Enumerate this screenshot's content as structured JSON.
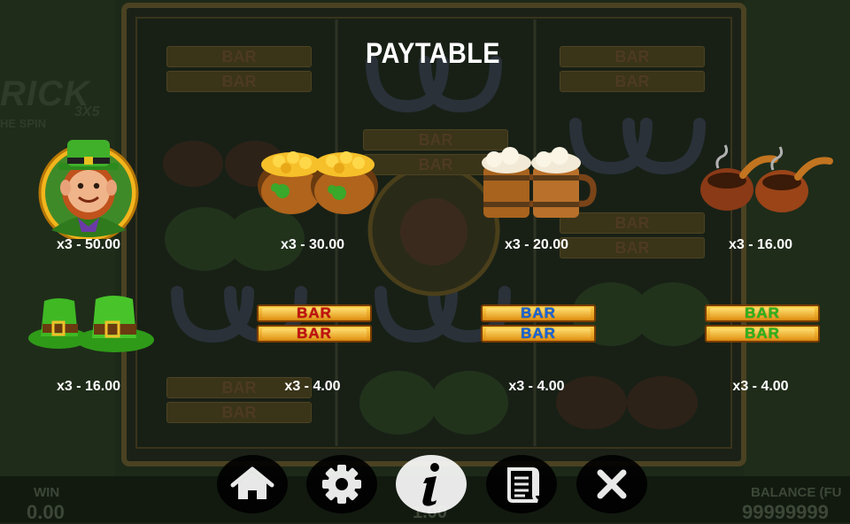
{
  "paytable": {
    "title": "PAYTABLE",
    "entries": [
      {
        "symbol": "leprechaun",
        "payout": "x3 - 50.00"
      },
      {
        "symbol": "pots-of-gold",
        "payout": "x3 - 30.00"
      },
      {
        "symbol": "beer-mugs",
        "payout": "x3 - 20.00"
      },
      {
        "symbol": "smoking-pipes",
        "payout": "x3 - 16.00"
      },
      {
        "symbol": "green-hats",
        "payout": "x3 - 16.00"
      },
      {
        "symbol": "red-bar",
        "payout": "x3 - 4.00",
        "bar_text": "BAR",
        "bar_color": "#c41010"
      },
      {
        "symbol": "blue-bar",
        "payout": "x3 - 4.00",
        "bar_text": "BAR",
        "bar_color": "#1a64d8"
      },
      {
        "symbol": "green-bar",
        "payout": "x3 - 4.00",
        "bar_text": "BAR",
        "bar_color": "#2cb51c"
      }
    ]
  },
  "menu": [
    {
      "name": "home",
      "icon": "home-icon"
    },
    {
      "name": "settings",
      "icon": "gear-icon"
    },
    {
      "name": "info",
      "icon": "info-icon",
      "active": true
    },
    {
      "name": "rules",
      "icon": "scroll-icon"
    },
    {
      "name": "close",
      "icon": "close-icon"
    }
  ],
  "background": {
    "logo": "RICK",
    "logo_sub": "HE SPIN",
    "logo_badge": "3X5",
    "bar_text": "BAR",
    "win_label": "WIN",
    "win_value": "0.00",
    "bet_value": "1.00",
    "balance_label": "BALANCE (FU",
    "balance_value": "99999999"
  },
  "colors": {
    "overlay_text": "#ffffff",
    "frame_gold": "#6b5a24",
    "background": "#1a2416",
    "active_button": "#ffffff"
  }
}
